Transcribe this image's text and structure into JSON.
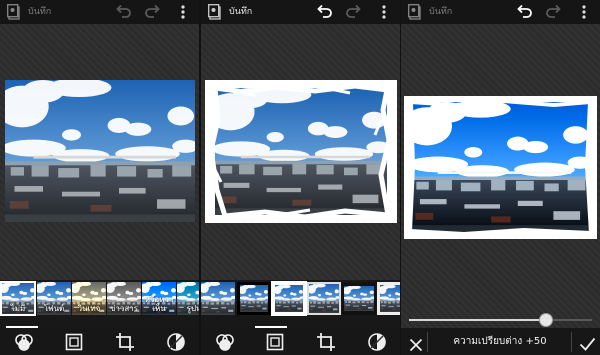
{
  "app": {
    "save_label": "บันทึก"
  },
  "filters": [
    {
      "label": "ไม่มี"
    },
    {
      "label": "โฟนต์"
    },
    {
      "label": "วินเทจ"
    },
    {
      "label": "ข่าวสาร"
    },
    {
      "label": "หวือหวาเห็น"
    },
    {
      "label": "รูปห"
    }
  ],
  "adjust": {
    "label": "ความเปรียบต่าง +50",
    "value": 50,
    "max": 100
  },
  "colors": {
    "sky": "#2d78c4",
    "topbar": "#151515",
    "panel": "#2c2c2c"
  },
  "icons": [
    "app-icon",
    "undo-icon",
    "redo-icon",
    "menu-icon",
    "effects-icon",
    "frame-icon",
    "crop-icon",
    "adjust-icon",
    "close-icon",
    "check-icon"
  ]
}
